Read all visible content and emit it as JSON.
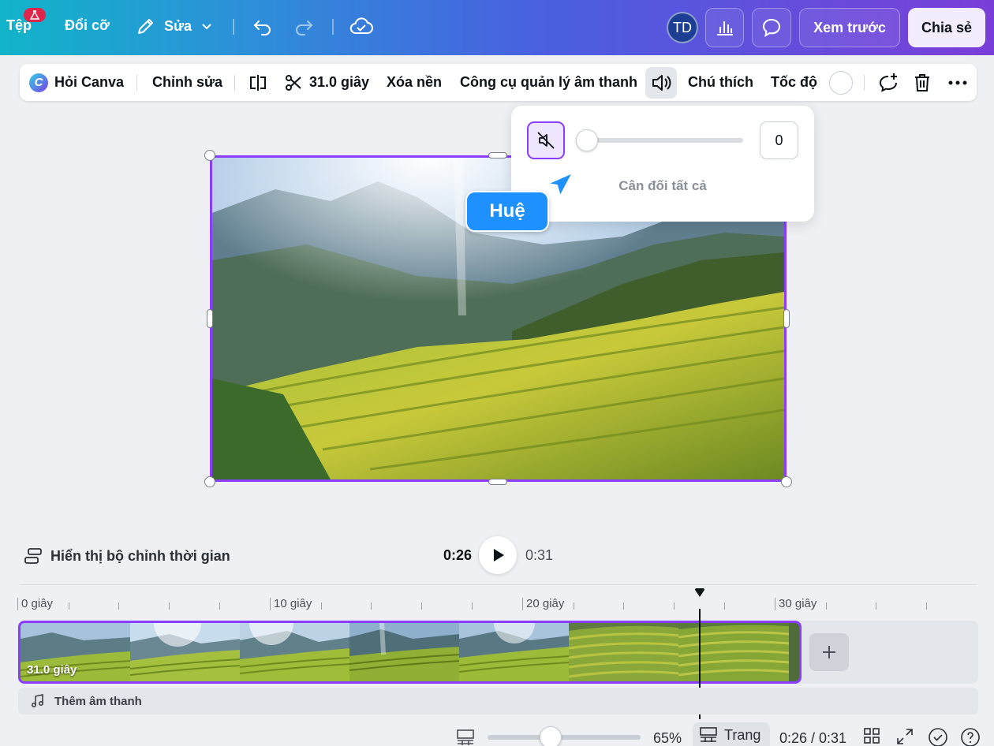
{
  "topbar": {
    "file_label": "Tệp",
    "resize_label": "Đổi cỡ",
    "edit_label": "Sửa",
    "avatar_initials": "TD",
    "preview_label": "Xem trước",
    "share_label": "Chia sẻ"
  },
  "context_toolbar": {
    "ask_canva": "Hỏi Canva",
    "edit": "Chỉnh sửa",
    "duration": "31.0 giây",
    "remove_bg": "Xóa nền",
    "audio_manager": "Công cụ quản lý âm thanh",
    "captions": "Chú thích",
    "speed": "Tốc độ"
  },
  "volume_popup": {
    "value": "0",
    "balance_all": "Cân đối tất cả"
  },
  "cursor_tag": {
    "name": "Huệ",
    "color": "#1e90ff"
  },
  "playback": {
    "timeline_toggle": "Hiển thị bộ chỉnh thời gian",
    "current_time": "0:26",
    "total_time": "0:31"
  },
  "ruler": {
    "labels": [
      "0 giây",
      "10 giây",
      "20 giây",
      "30 giây"
    ]
  },
  "clip": {
    "duration": "31.0 giây"
  },
  "audio_track": {
    "add_audio": "Thêm âm thanh"
  },
  "status": {
    "zoom": "65%",
    "page_label": "Trang",
    "time": "0:26 / 0:31"
  },
  "colors": {
    "accent": "#8b3dff",
    "share_bg": "#f3ecff",
    "badge": "#e0254b"
  }
}
